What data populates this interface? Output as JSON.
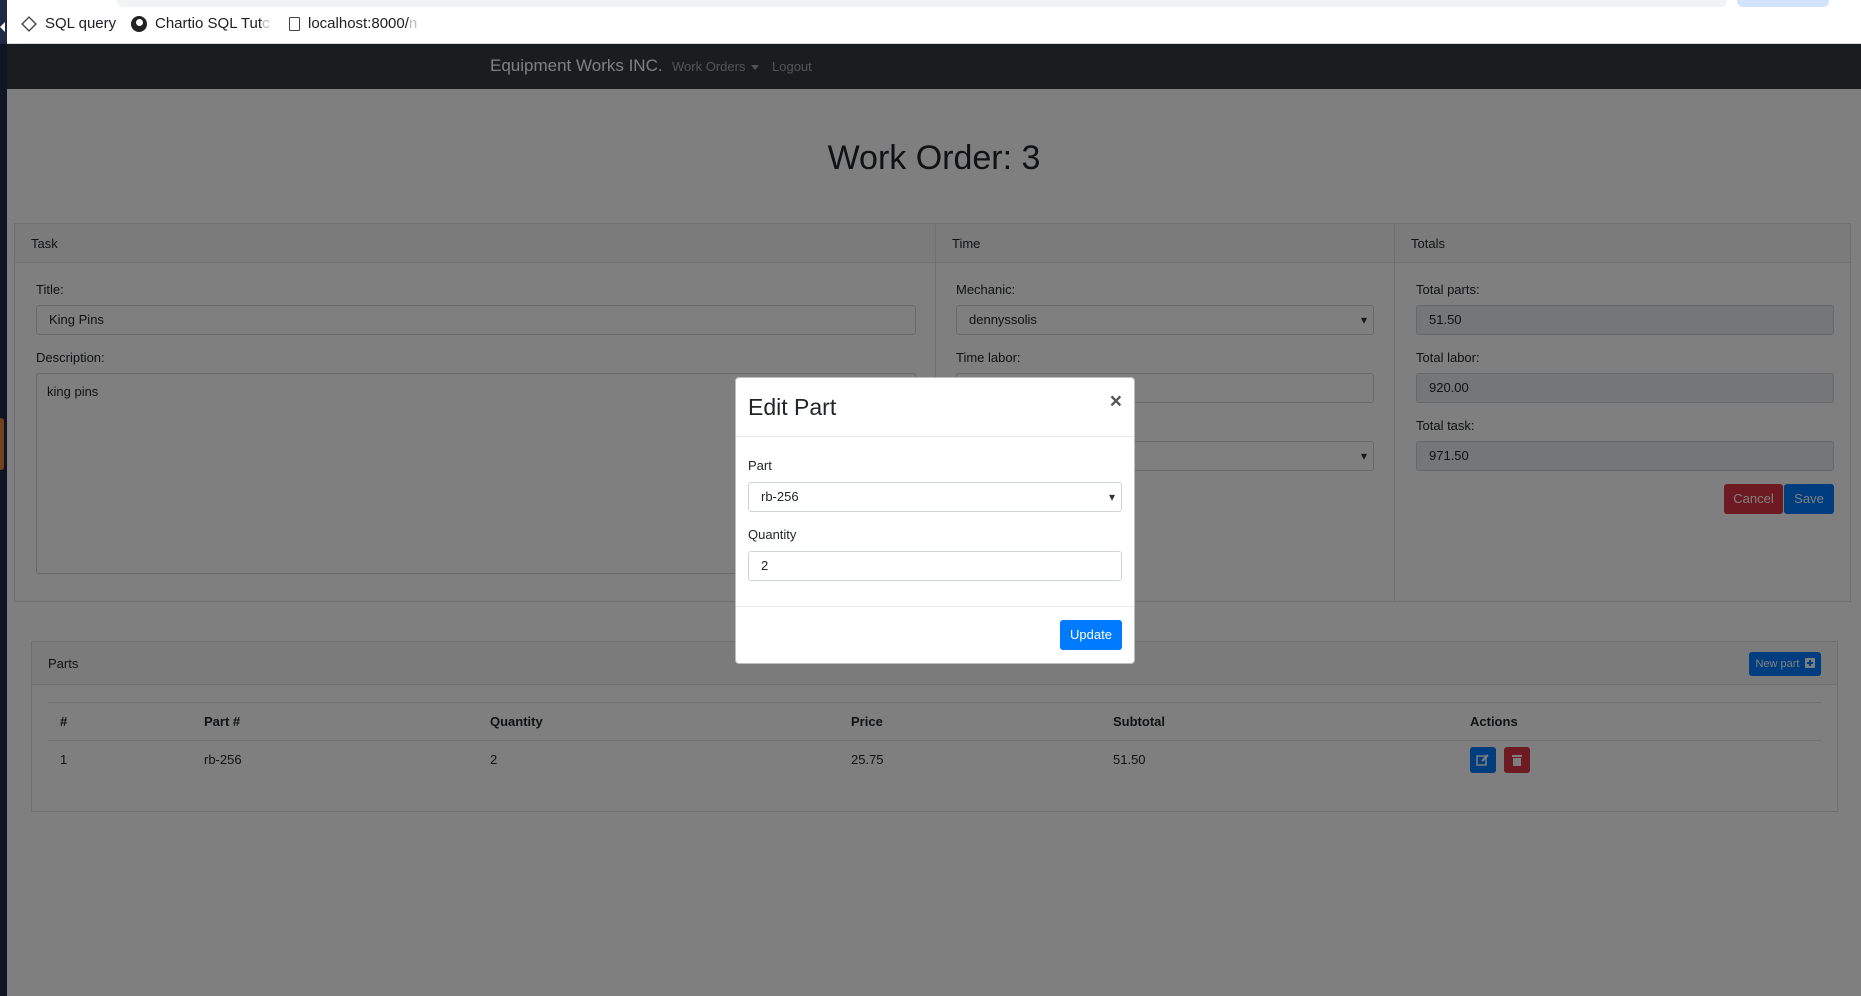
{
  "browser": {
    "bookmarks": [
      {
        "label": "SQL query",
        "icon": "diamond-icon"
      },
      {
        "label": "Chartio SQL Tut",
        "faded": "c",
        "icon": "chartio-icon"
      },
      {
        "label": "localhost:8000/",
        "faded": "n",
        "icon": "page-icon"
      }
    ]
  },
  "navbar": {
    "brand": "Equipment Works INC.",
    "work_orders": "Work Orders",
    "logout": "Logout"
  },
  "page": {
    "title": "Work Order: 3"
  },
  "task_card": {
    "header": "Task",
    "title_label": "Title:",
    "title_value": "King Pins",
    "description_label": "Description:",
    "description_value": "king pins"
  },
  "time_card": {
    "header": "Time",
    "mechanic_label": "Mechanic:",
    "mechanic_value": "dennyssolis",
    "time_labor_label": "Time labor:"
  },
  "totals_card": {
    "header": "Totals",
    "parts_label": "Total parts:",
    "parts_value": "51.50",
    "labor_label": "Total labor:",
    "labor_value": "920.00",
    "task_label": "Total task:",
    "task_value": "971.50",
    "cancel_label": "Cancel",
    "save_label": "Save"
  },
  "parts_card": {
    "header": "Parts",
    "new_part_label": "New part",
    "columns": [
      "#",
      "Part #",
      "Quantity",
      "Price",
      "Subtotal",
      "Actions"
    ],
    "rows": [
      {
        "num": "1",
        "part": "rb-256",
        "quantity": "2",
        "price": "25.75",
        "subtotal": "51.50"
      }
    ]
  },
  "modal": {
    "title": "Edit Part",
    "close": "×",
    "part_label": "Part",
    "part_value": "rb-256",
    "quantity_label": "Quantity",
    "quantity_value": "2",
    "update_label": "Update"
  },
  "colors": {
    "navbar": "#343a40",
    "primary": "#007bff",
    "danger": "#dc3545"
  }
}
